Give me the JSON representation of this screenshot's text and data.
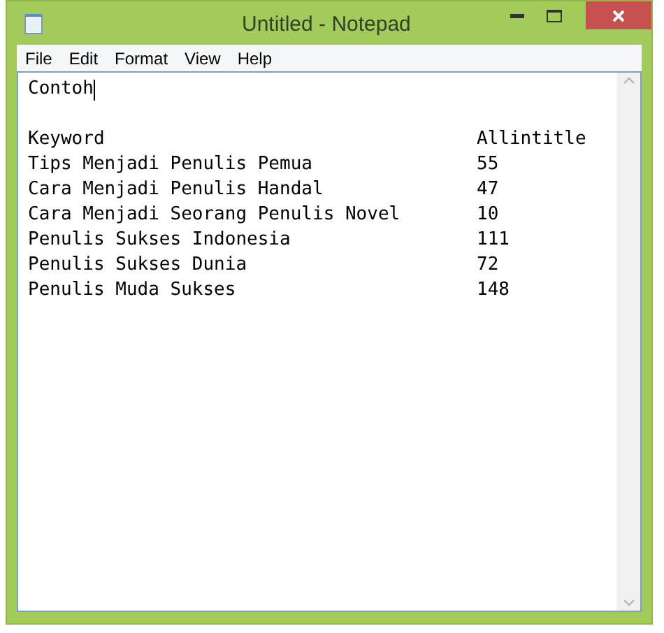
{
  "window": {
    "title": "Untitled - Notepad"
  },
  "menu": [
    "File",
    "Edit",
    "Format",
    "View",
    "Help"
  ],
  "document": {
    "heading": "Contoh",
    "caret": true,
    "columns": [
      "Keyword",
      "Allintitle"
    ],
    "rows": [
      [
        "Tips Menjadi Penulis Pemua",
        "55"
      ],
      [
        "Cara Menjadi Penulis Handal",
        "47"
      ],
      [
        "Cara Menjadi Seorang Penulis Novel",
        "10"
      ],
      [
        "Penulis Sukses Indonesia",
        "111"
      ],
      [
        "Penulis Sukses Dunia",
        "72"
      ],
      [
        "Penulis Muda Sukses",
        "148"
      ]
    ]
  }
}
